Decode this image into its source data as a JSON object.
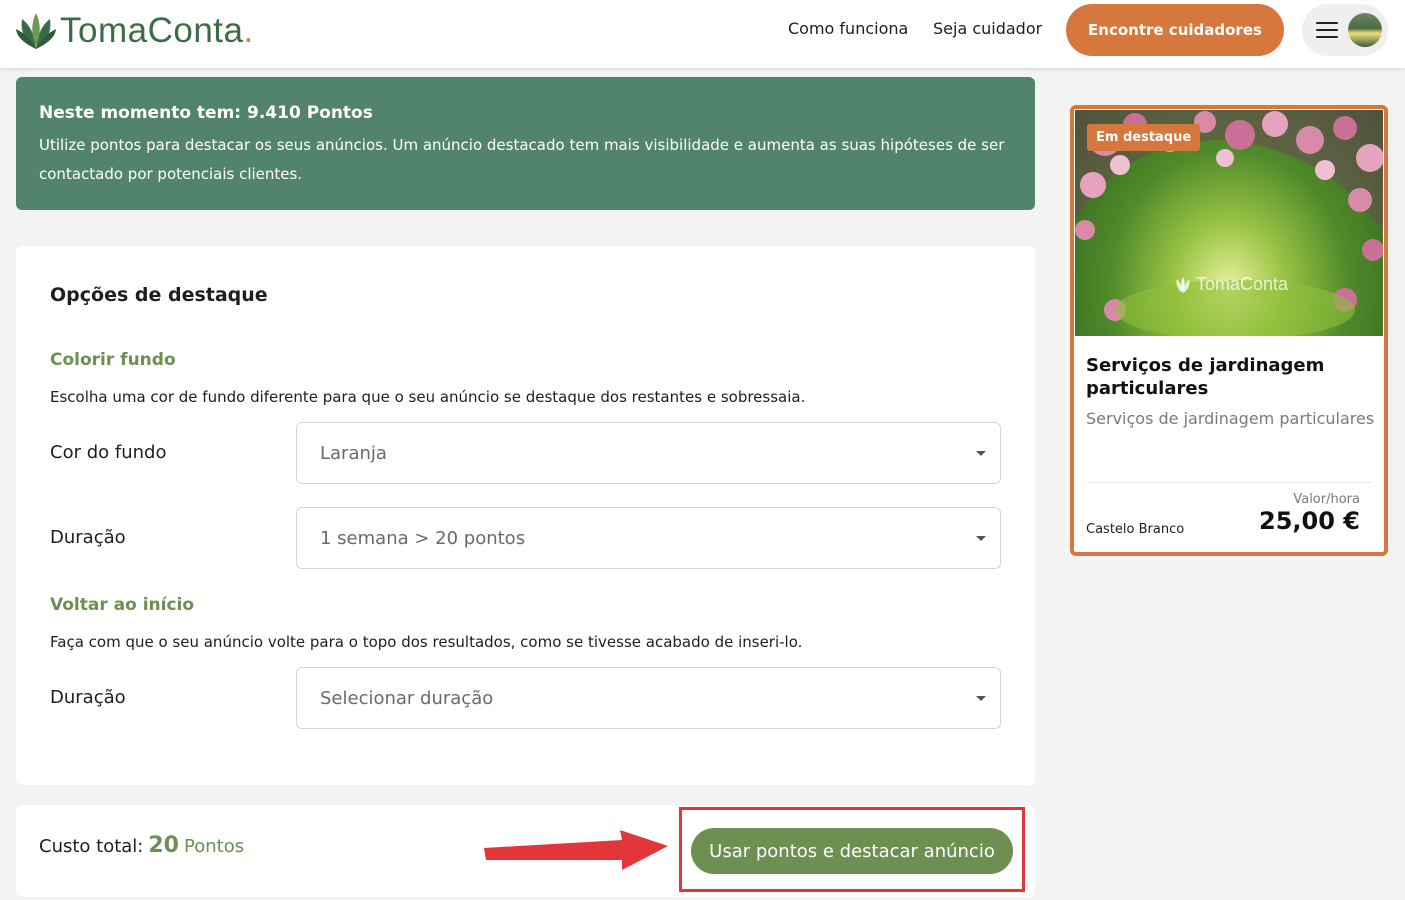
{
  "header": {
    "logo_text": "TomaConta",
    "nav": [
      "Como funciona",
      "Seja cuidador"
    ],
    "cta_label": "Encontre cuidadores"
  },
  "banner": {
    "title": "Neste momento tem: 9.410 Pontos",
    "text": "Utilize pontos para destacar os seus anúncios. Um anúncio destacado tem mais visibilidade e aumenta as suas hipóteses de ser contactado por potenciais clientes."
  },
  "options": {
    "title": "Opções de destaque",
    "colorir": {
      "title": "Colorir fundo",
      "desc": "Escolha uma cor de fundo diferente para que o seu anúncio se destaque dos restantes e sobressaia.",
      "cor_label": "Cor do fundo",
      "cor_value": "Laranja",
      "duracao_label": "Duração",
      "duracao_value": "1 semana > 20 pontos"
    },
    "voltar": {
      "title": "Voltar ao início",
      "desc": "Faça com que o seu anúncio volte para o topo dos resultados, como se tivesse acabado de inseri-lo.",
      "duracao_label": "Duração",
      "duracao_placeholder": "Selecionar duração"
    }
  },
  "total": {
    "label": "Custo total:",
    "value": "20",
    "unit": "Pontos",
    "submit_label": "Usar pontos e destacar anúncio"
  },
  "preview": {
    "badge": "Em destaque",
    "watermark": "TomaConta",
    "title": "Serviços de jardinagem particulares",
    "subtitle": "Serviços de jardinagem particulares",
    "rate_label": "Valor/hora",
    "price": "25,00 €",
    "location": "Castelo Branco"
  },
  "colors": {
    "brand_green": "#52846d",
    "accent_green": "#6d8f52",
    "accent_orange": "#d6773d",
    "annotation_red": "#e3363b"
  },
  "icons": [
    "tomaconta-logo-icon",
    "hamburger-icon",
    "avatar",
    "chevron-down-icon",
    "annotation-arrow"
  ]
}
